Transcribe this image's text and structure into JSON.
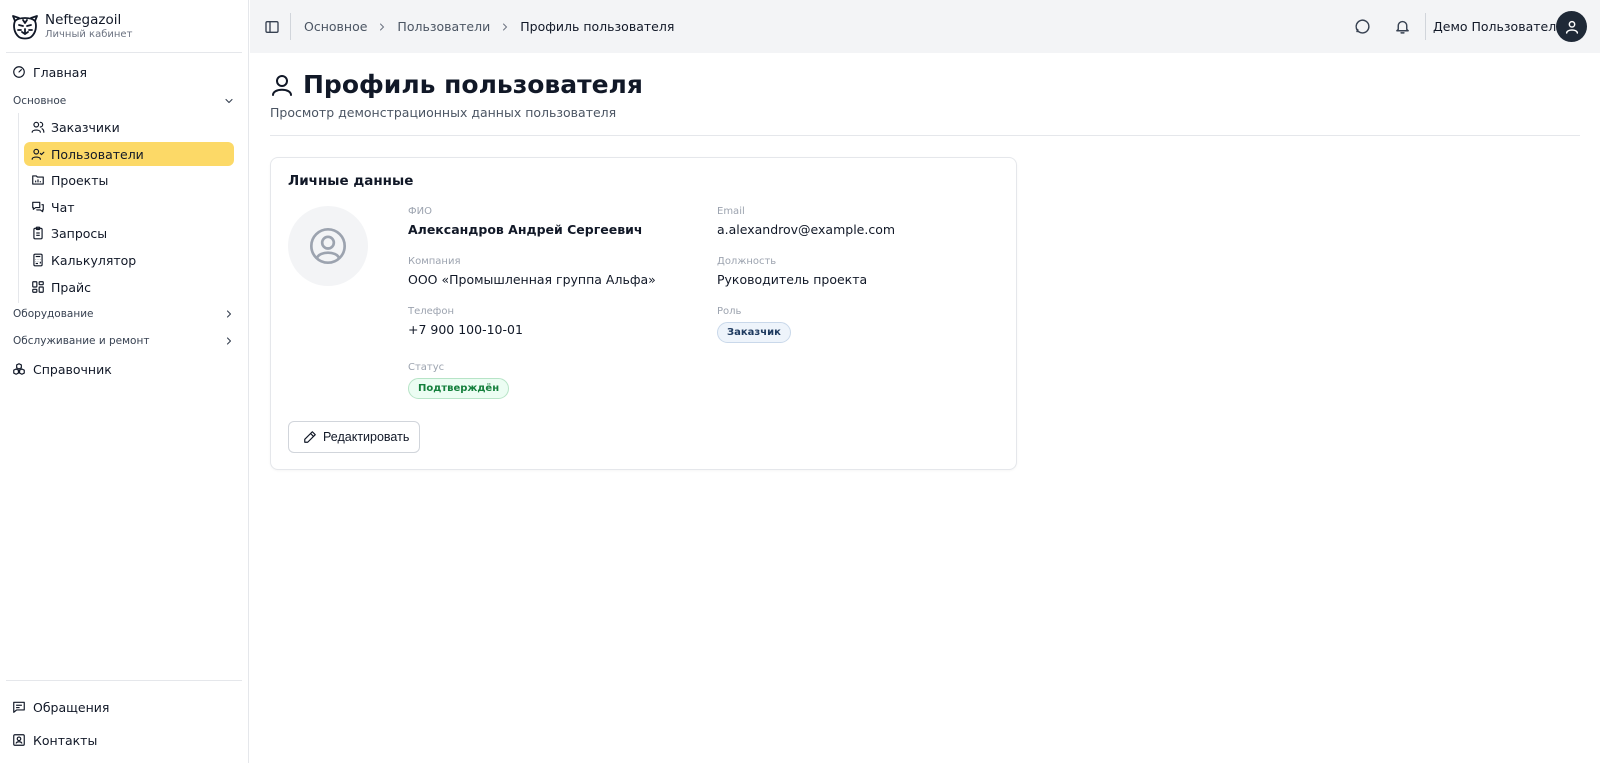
{
  "brand": {
    "name": "Neftegazoil",
    "subtitle": "Личный кабинет"
  },
  "sidebar": {
    "home": {
      "label": "Главная",
      "icon": "gauge-icon"
    },
    "groups": [
      {
        "label": "Основное",
        "expanded": true
      },
      {
        "label": "Оборудование",
        "expanded": false
      },
      {
        "label": "Обслуживание и ремонт",
        "expanded": false
      }
    ],
    "items": [
      {
        "label": "Заказчики",
        "icon": "users-icon",
        "active": false
      },
      {
        "label": "Пользователи",
        "icon": "user-check-icon",
        "active": true
      },
      {
        "label": "Проекты",
        "icon": "folder-chart-icon",
        "active": false
      },
      {
        "label": "Чат",
        "icon": "messages-icon",
        "active": false
      },
      {
        "label": "Запросы",
        "icon": "clipboard-icon",
        "active": false
      },
      {
        "label": "Калькулятор",
        "icon": "calculator-icon",
        "active": false
      },
      {
        "label": "Прайс",
        "icon": "grid-icon",
        "active": false
      }
    ],
    "reference": {
      "label": "Справочник",
      "icon": "boxes-icon"
    },
    "bottom": [
      {
        "label": "Обращения",
        "icon": "message-square-icon"
      },
      {
        "label": "Контакты",
        "icon": "contact-icon"
      }
    ]
  },
  "topbar": {
    "breadcrumbs": [
      "Основное",
      "Пользователи",
      "Профиль пользователя"
    ],
    "user_name": "Демо Пользователь"
  },
  "page": {
    "title": "Профиль пользователя",
    "subtitle": "Просмотр демонстрационных данных пользователя"
  },
  "card": {
    "title": "Личные данные",
    "fields": {
      "fio": {
        "label": "ФИО",
        "value": "Александров Андрей Сергеевич"
      },
      "email": {
        "label": "Email",
        "value": "a.alexandrov@example.com"
      },
      "company": {
        "label": "Компания",
        "value": "ООО «Промышленная группа Альфа»"
      },
      "position": {
        "label": "Должность",
        "value": "Руководитель проекта"
      },
      "phone": {
        "label": "Телефон",
        "value": "+7 900 100-10-01"
      },
      "role": {
        "label": "Роль",
        "value": "Заказчик"
      },
      "status": {
        "label": "Статус",
        "value": "Подтверждён"
      }
    },
    "edit_label": "Редактировать"
  },
  "colors": {
    "active_nav": "#fcd967",
    "status_green": "#15803d",
    "role_blue": "#1e3a5f"
  }
}
